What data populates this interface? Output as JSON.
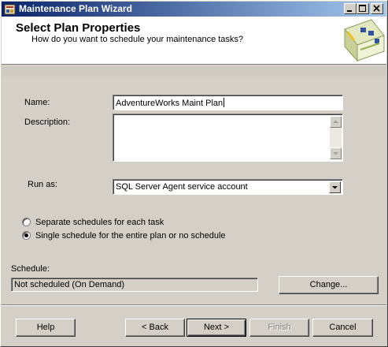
{
  "window": {
    "title": "Maintenance Plan Wizard"
  },
  "header": {
    "title": "Select Plan Properties",
    "subtitle": "How do you want to schedule your maintenance tasks?"
  },
  "form": {
    "name_label": "Name:",
    "name_value": "AdventureWorks Maint Plan",
    "description_label": "Description:",
    "description_value": "",
    "run_as_label": "Run as:",
    "run_as_value": "SQL Server Agent service account"
  },
  "schedule_options": [
    {
      "label": "Separate schedules for each task",
      "selected": false
    },
    {
      "label": "Single schedule for the entire plan or no schedule",
      "selected": true
    }
  ],
  "schedule": {
    "label": "Schedule:",
    "value": "Not scheduled (On Demand)",
    "change_label": "Change..."
  },
  "footer": {
    "help_label": "Help",
    "back_label": "< Back",
    "next_label": "Next >",
    "finish_label": "Finish",
    "cancel_label": "Cancel"
  },
  "icons": {
    "app": "wizard-app-icon",
    "minimize": "minimize-icon",
    "maximize": "maximize-icon",
    "close": "close-icon",
    "header_graphic": "maintenance-plan-graphic",
    "scroll_up": "scroll-up-arrow-icon",
    "scroll_down": "scroll-down-arrow-icon",
    "dropdown": "dropdown-arrow-icon"
  },
  "colors": {
    "title_bar_start": "#0a246a",
    "title_bar_end": "#a6caf0",
    "dialog_face": "#d4d0c8",
    "header_background": "#ffffff"
  }
}
